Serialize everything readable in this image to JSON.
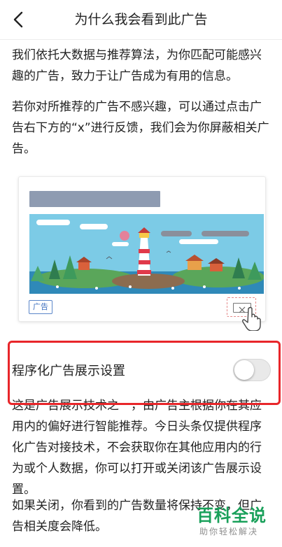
{
  "header": {
    "title": "为什么我会看到此广告",
    "back_icon": "chevron-left-icon"
  },
  "content": {
    "paragraph1": "我们依托大数据与推荐算法，为你匹配可能感兴趣的广告，致力于让广告成为有用的信息。",
    "paragraph2": "若你对所推荐的广告不感兴趣，可以通过点击广告右下方的“x”进行反馈，我们会为你屏蔽相关广告。",
    "paragraph3": "这是广告展示技术之一，由广告主根据你在其应用内的偏好进行智能推荐。今日头条仅提供程序化广告对接技术，不会获取你在其他应用内的行为或个人数据，你可以打开或关闭该广告展示设置。",
    "paragraph4": "如果关闭，你看到的广告数量将保持不变，但广告相关度会降低。"
  },
  "illustration": {
    "ad_tag": "广告",
    "close_icon": "close-x-icon",
    "hand_icon": "hand-pointer-icon"
  },
  "setting": {
    "label": "程序化广告展示设置",
    "enabled": false
  },
  "watermark": {
    "title": "百科全说",
    "subtitle": "助你轻松解决"
  },
  "colors": {
    "highlight_frame": "#e8262a",
    "watermark_green": "#19a05a"
  }
}
